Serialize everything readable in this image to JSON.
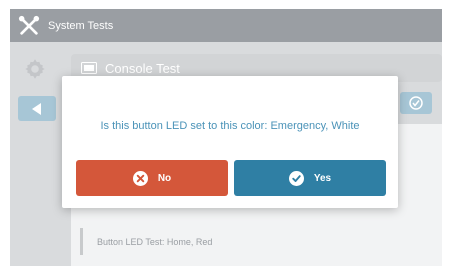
{
  "titlebar": {
    "title": "System Tests",
    "icon": "tools-icon"
  },
  "console": {
    "label": "Console Test",
    "icon": "monitor-icon"
  },
  "log": {
    "row_text": "Button LED Test: Home, Red"
  },
  "dialog": {
    "question": "Is this button LED set to this color: Emergency, White",
    "no_label": "No",
    "yes_label": "Yes"
  },
  "colors": {
    "titlebar": "#9a9ea3",
    "accent_blue": "#2f7fa4",
    "danger_red": "#d4573a",
    "question_text": "#4b93b8"
  }
}
